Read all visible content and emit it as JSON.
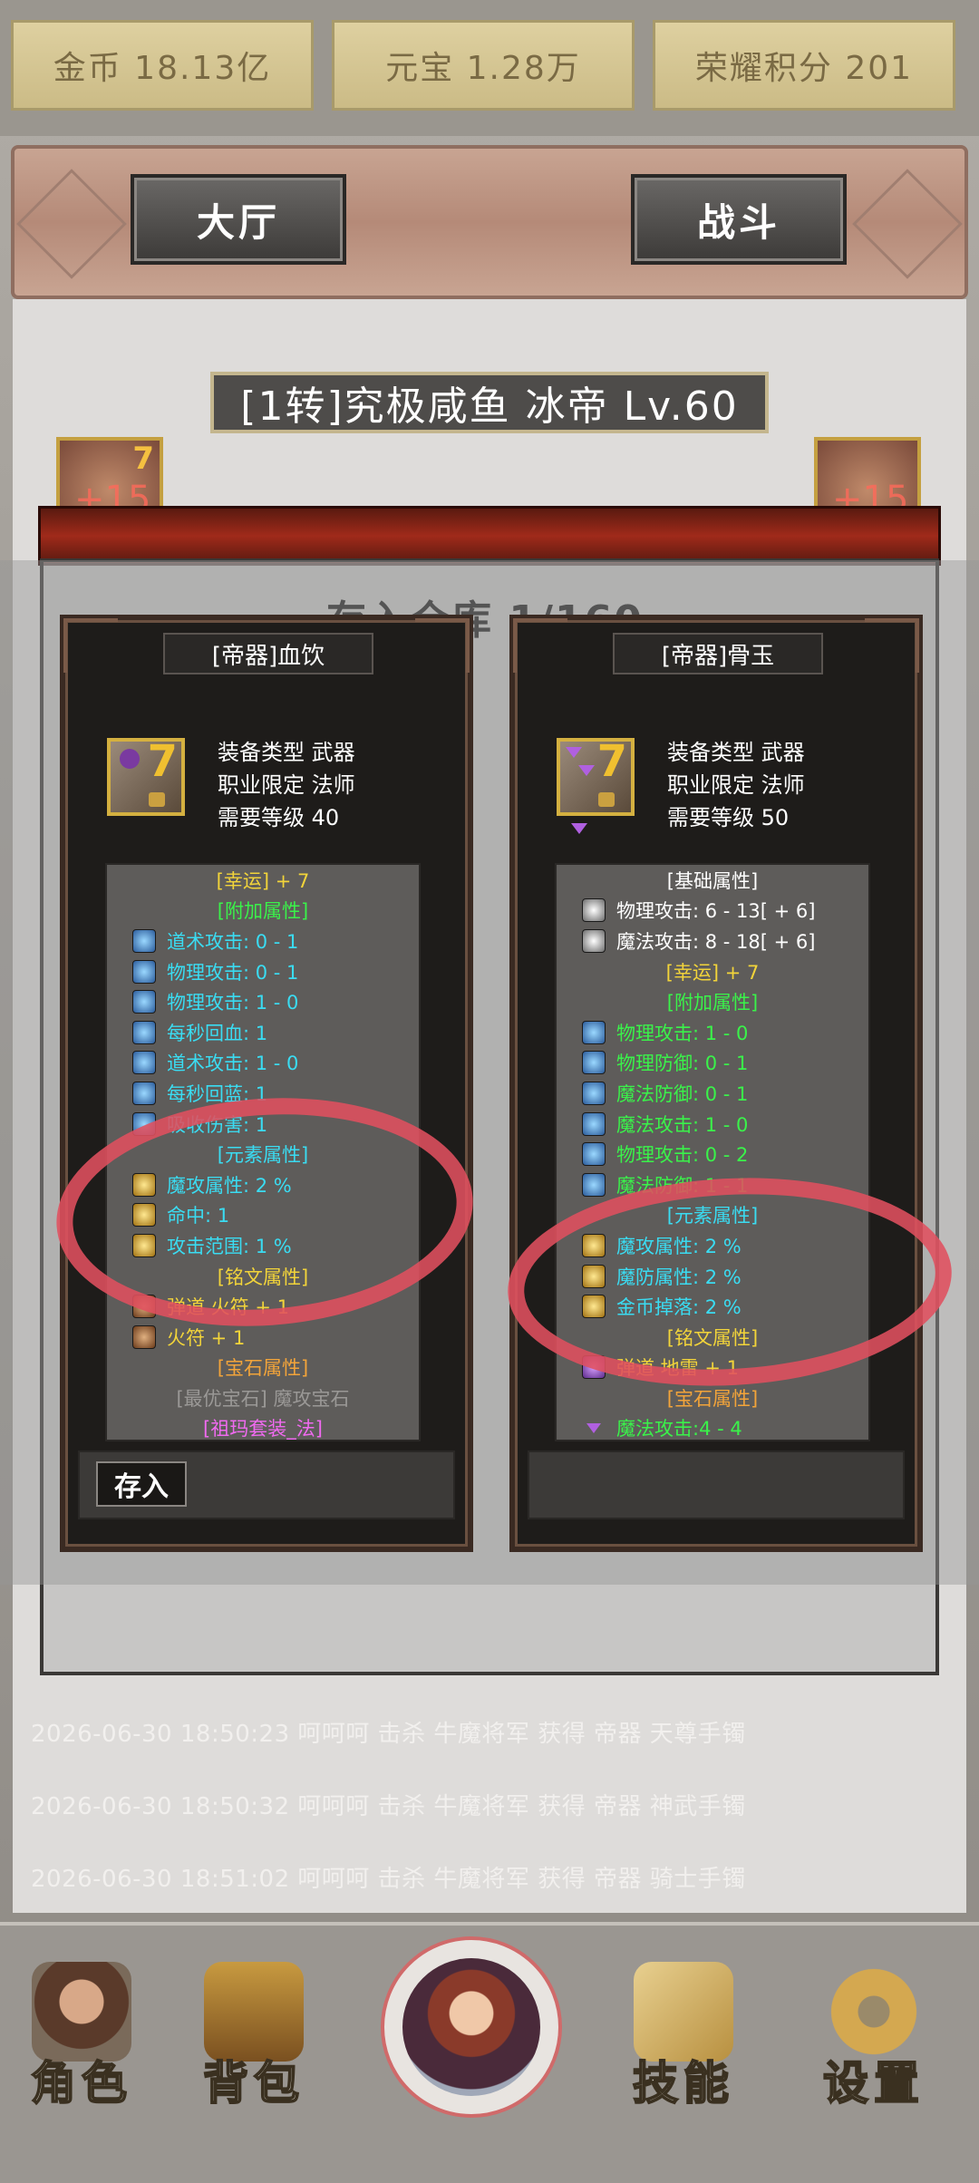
{
  "currencies": [
    {
      "label": "金币 18.13亿"
    },
    {
      "label": "元宝 1.28万"
    },
    {
      "label": "荣耀积分 201"
    }
  ],
  "nav": {
    "hall": "大厅",
    "battle": "战斗"
  },
  "character": {
    "title": "[1转]究极咸鱼 冰帝 Lv.60",
    "left_slot": {
      "level": "7",
      "enhance": "+15"
    },
    "right_slot": {
      "enhance": "+15"
    }
  },
  "modal": {
    "title": "存入仓库 1/160"
  },
  "items": [
    {
      "name": "[帝器]血饮",
      "level_badge": "7",
      "basic": [
        "装备类型 武器",
        "职业限定 法师",
        "需要等级 40"
      ],
      "attributes": [
        {
          "text": "[幸运] + 7",
          "color": "yellow",
          "header": true
        },
        {
          "text": "[附加属性]",
          "color": "green",
          "header": true
        },
        {
          "text": "道术攻击: 0 - 1",
          "color": "cyan",
          "icon": "blue"
        },
        {
          "text": "物理攻击: 0 - 1",
          "color": "cyan",
          "icon": "blue"
        },
        {
          "text": "物理攻击: 1 - 0",
          "color": "cyan",
          "icon": "blue"
        },
        {
          "text": "每秒回血: 1",
          "color": "cyan",
          "icon": "blue"
        },
        {
          "text": "道术攻击: 1 - 0",
          "color": "cyan",
          "icon": "blue"
        },
        {
          "text": "每秒回蓝: 1",
          "color": "cyan",
          "icon": "blue"
        },
        {
          "text": "吸收伤害: 1",
          "color": "cyan",
          "icon": "blue"
        },
        {
          "text": "[元素属性]",
          "color": "cyan",
          "header": true
        },
        {
          "text": "魔攻属性: 2 %",
          "color": "cyan",
          "icon": "gold"
        },
        {
          "text": "命中: 1",
          "color": "cyan",
          "icon": "gold"
        },
        {
          "text": "攻击范围: 1 %",
          "color": "cyan",
          "icon": "gold"
        },
        {
          "text": "[铭文属性]",
          "color": "yellow",
          "header": true
        },
        {
          "text": "弹道 火符 + 1",
          "color": "yellow",
          "icon": "brown"
        },
        {
          "text": "火符 + 1",
          "color": "yellow",
          "icon": "brown"
        },
        {
          "text": "[宝石属性]",
          "color": "orange",
          "header": true
        },
        {
          "text": "[最优宝石] 魔攻宝石",
          "color": "grey",
          "header": true
        },
        {
          "text": "[祖玛套装_法]",
          "color": "pink",
          "header": true
        }
      ],
      "store_label": "存入"
    },
    {
      "name": "[帝器]骨玉",
      "level_badge": "7",
      "basic": [
        "装备类型 武器",
        "职业限定 法师",
        "需要等级 50"
      ],
      "attributes": [
        {
          "text": "[基础属性]",
          "color": "white",
          "header": true
        },
        {
          "text": "物理攻击: 6 - 13[ + 6]",
          "color": "white",
          "icon": "grey"
        },
        {
          "text": "魔法攻击: 8 - 18[ + 6]",
          "color": "white",
          "icon": "grey"
        },
        {
          "text": "[幸运] + 7",
          "color": "yellow",
          "header": true
        },
        {
          "text": "[附加属性]",
          "color": "green",
          "header": true
        },
        {
          "text": "物理攻击: 1 - 0",
          "color": "green",
          "icon": "blue"
        },
        {
          "text": "物理防御: 0 - 1",
          "color": "green",
          "icon": "blue"
        },
        {
          "text": "魔法防御: 0 - 1",
          "color": "green",
          "icon": "blue"
        },
        {
          "text": "魔法攻击: 1 - 0",
          "color": "green",
          "icon": "blue"
        },
        {
          "text": "物理攻击: 0 - 2",
          "color": "green",
          "icon": "blue"
        },
        {
          "text": "魔法防御: 1 - 1",
          "color": "green",
          "icon": "blue"
        },
        {
          "text": "[元素属性]",
          "color": "cyan",
          "header": true
        },
        {
          "text": "魔攻属性: 2 %",
          "color": "cyan",
          "icon": "gold"
        },
        {
          "text": "魔防属性: 2 %",
          "color": "cyan",
          "icon": "gold"
        },
        {
          "text": "金币掉落: 2 %",
          "color": "cyan",
          "icon": "gold"
        },
        {
          "text": "[铭文属性]",
          "color": "yellow",
          "header": true
        },
        {
          "text": "弹道 地雷 + 1",
          "color": "yellow",
          "icon": "purple"
        },
        {
          "text": "[宝石属性]",
          "color": "orange",
          "header": true
        },
        {
          "text": "魔法攻击:4 - 4",
          "color": "green",
          "icon": "tri"
        }
      ],
      "store_label": ""
    }
  ],
  "log": [
    "2026-06-30 18:50:23 呵呵呵 击杀 牛魔将军 获得 帝器 天尊手镯",
    "2026-06-30 18:50:32 呵呵呵 击杀 牛魔将军 获得 帝器 神武手镯",
    "2026-06-30 18:51:02 呵呵呵 击杀 牛魔将军 获得 帝器 骑士手镯"
  ],
  "bottom_nav": {
    "character": "角色",
    "bag": "背包",
    "skills": "技能",
    "settings": "设置"
  },
  "colors": {
    "annotation": "#e0505e",
    "gold_panel": "#cbbb86",
    "attr_cyan": "#3adcf2",
    "attr_green": "#3af24a",
    "attr_yellow": "#f2d43a"
  }
}
